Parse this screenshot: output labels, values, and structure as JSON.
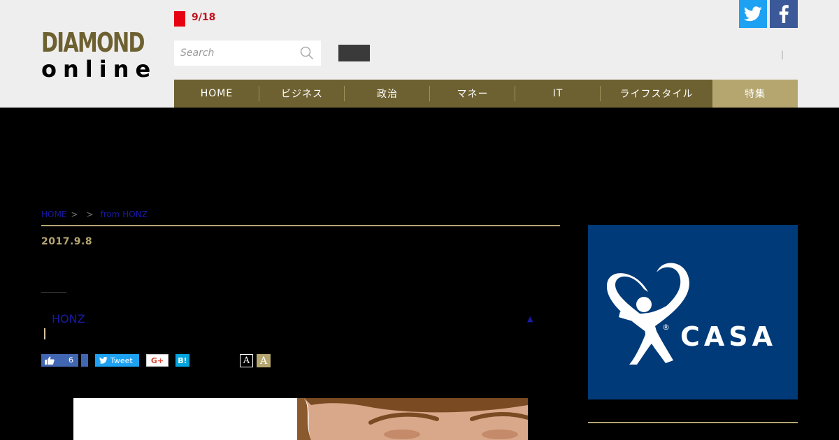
{
  "header": {
    "logo_top": "DIAMOND",
    "logo_bottom": "online",
    "date": "9/18",
    "search_placeholder": "Search",
    "separator": "|",
    "twitter_icon": "twitter-icon",
    "facebook_icon": "facebook-icon"
  },
  "nav": {
    "items": [
      {
        "label": "HOME"
      },
      {
        "label": "ビジネス"
      },
      {
        "label": "政治"
      },
      {
        "label": "マネー"
      },
      {
        "label": "IT"
      },
      {
        "label": "ライフスタイル"
      },
      {
        "label": "特集"
      }
    ]
  },
  "breadcrumb": {
    "home": "HOME",
    "sep1": ">",
    "sep2": ">",
    "current": "from HONZ"
  },
  "article": {
    "date": "2017.9.8",
    "author": "HONZ",
    "up_arrow": "▲"
  },
  "share": {
    "like_count": "6",
    "tweet_label": "Tweet",
    "gplus_label": "G+",
    "hatena_label": "B!",
    "font_small": "A",
    "font_large": "A"
  },
  "ad": {
    "brand": "CASA",
    "registered": "®"
  },
  "colors": {
    "brand_gold": "#6e6131",
    "accent_gold": "#b5a670",
    "twitter": "#1da1f2",
    "facebook": "#3b5998",
    "date_red": "#e60012",
    "ad_blue": "#003a78"
  }
}
